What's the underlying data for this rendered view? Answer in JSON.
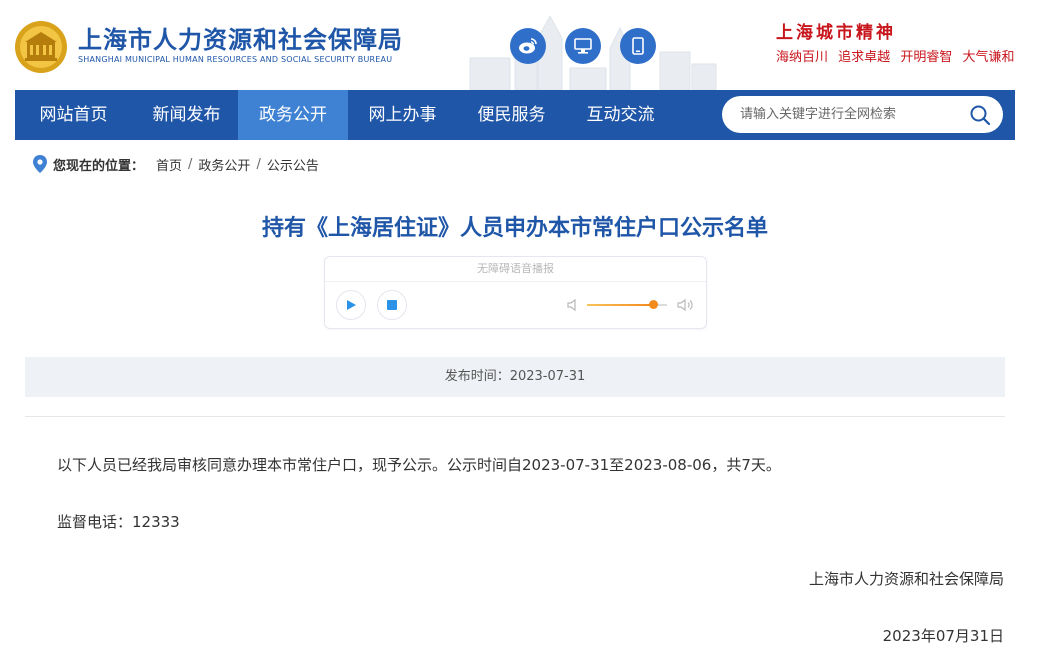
{
  "header": {
    "org_name_cn": "上海市人力资源和社会保障局",
    "org_name_en": "SHANGHAI MUNICIPAL HUMAN RESOURCES AND SOCIAL SECURITY BUREAU",
    "spirit_title": "上海城市精神",
    "slogans": [
      "海纳百川",
      "追求卓越",
      "开明睿智",
      "大气谦和"
    ],
    "buttons": [
      {
        "icon": "weibo-icon"
      },
      {
        "icon": "desktop-icon"
      },
      {
        "icon": "mobile-icon"
      }
    ]
  },
  "nav": {
    "items": [
      {
        "label": "网站首页",
        "active": false
      },
      {
        "label": "新闻发布",
        "active": false
      },
      {
        "label": "政务公开",
        "active": true
      },
      {
        "label": "网上办事",
        "active": false
      },
      {
        "label": "便民服务",
        "active": false
      },
      {
        "label": "互动交流",
        "active": false
      }
    ],
    "search_placeholder": "请输入关键字进行全网检索"
  },
  "breadcrumb": {
    "label": "您现在的位置：",
    "items": [
      "首页",
      "政务公开",
      "公示公告"
    ]
  },
  "article": {
    "title": "持有《上海居住证》人员申办本市常住户口公示名单",
    "publish_time": "发布时间：2023-07-31",
    "paragraph1": "以下人员已经我局审核同意办理本市常住户口，现予公示。公示时间自2023-07-31至2023-08-06，共7天。",
    "paragraph2": "监督电话：12333",
    "signature": "上海市人力资源和社会保障局",
    "date": "2023年07月31日"
  },
  "player": {
    "title": "无障碍语音播报",
    "volume_level": 0.82
  },
  "colors": {
    "brand_blue": "#1f56a8",
    "nav_active": "#3f82d3",
    "slogan_red": "#c8161d",
    "volume_orange": "#f28a1c"
  }
}
